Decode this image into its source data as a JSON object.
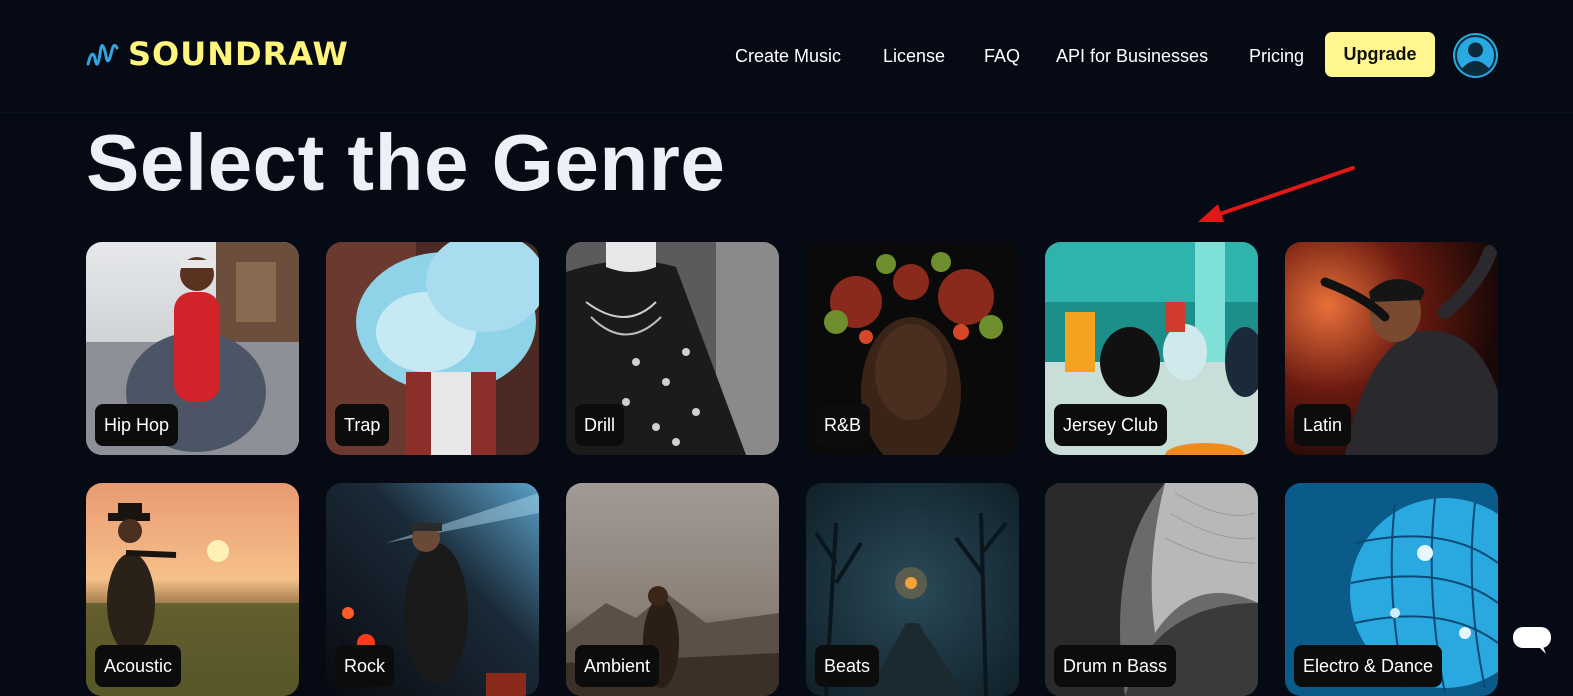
{
  "header": {
    "brand": "SOUNDRAW",
    "nav": [
      {
        "label": "Create Music"
      },
      {
        "label": "License"
      },
      {
        "label": "FAQ"
      },
      {
        "label": "API for Businesses"
      },
      {
        "label": "Pricing"
      }
    ],
    "upgrade_label": "Upgrade"
  },
  "main": {
    "title": "Select the Genre",
    "genres": [
      {
        "label": "Hip Hop"
      },
      {
        "label": "Trap"
      },
      {
        "label": "Drill"
      },
      {
        "label": "R&B"
      },
      {
        "label": "Jersey Club"
      },
      {
        "label": "Latin"
      },
      {
        "label": "Acoustic"
      },
      {
        "label": "Rock"
      },
      {
        "label": "Ambient"
      },
      {
        "label": "Beats"
      },
      {
        "label": "Drum n Bass"
      },
      {
        "label": "Electro & Dance"
      }
    ]
  },
  "icons": {
    "avatar": "user-avatar-icon",
    "chat": "chat-bubble-icon",
    "annotation": "red-arrow-annotation"
  },
  "colors": {
    "background": "#050a14",
    "brand_yellow": "#fff57a",
    "upgrade_button": "#fff68f",
    "avatar_blue": "#29a9e1",
    "annotation_red": "#e01818"
  }
}
